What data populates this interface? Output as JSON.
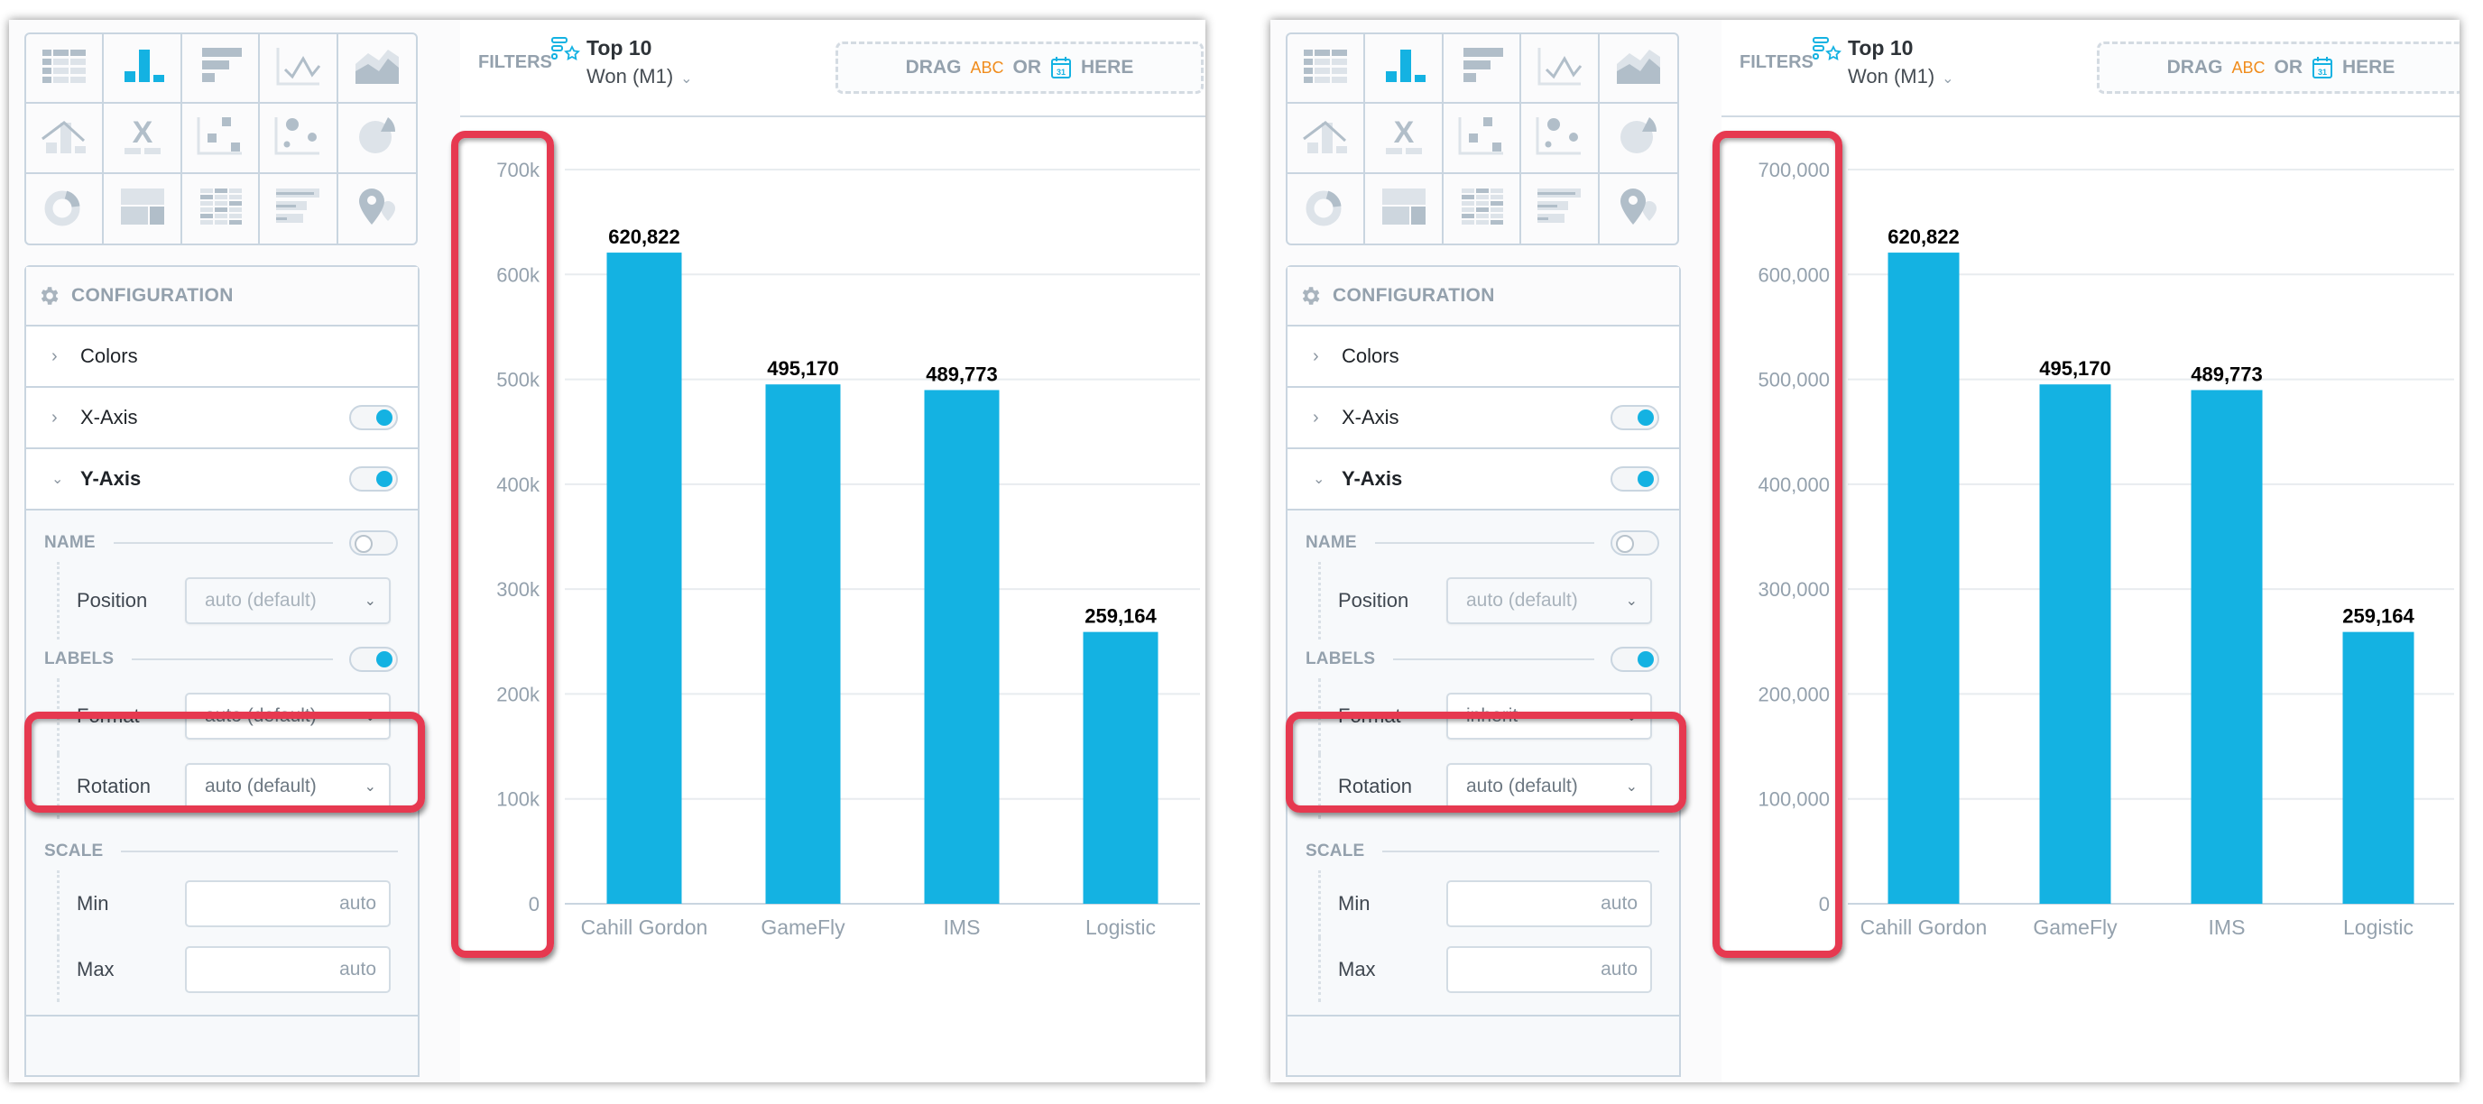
{
  "viz_types": [
    {
      "name": "table",
      "active": false
    },
    {
      "name": "column",
      "active": true
    },
    {
      "name": "bar",
      "active": false
    },
    {
      "name": "line",
      "active": false
    },
    {
      "name": "area",
      "active": false
    },
    {
      "name": "combo",
      "active": false
    },
    {
      "name": "headline",
      "active": false
    },
    {
      "name": "scatter",
      "active": false
    },
    {
      "name": "bubble",
      "active": false
    },
    {
      "name": "pie",
      "active": false
    },
    {
      "name": "donut",
      "active": false
    },
    {
      "name": "treemap",
      "active": false
    },
    {
      "name": "heatmap",
      "active": false
    },
    {
      "name": "bullet",
      "active": false
    },
    {
      "name": "geo",
      "active": false
    }
  ],
  "colors": {
    "accent": "#14b2e2",
    "bar": "#14b2e2",
    "highlight": "#e63950",
    "muted": "#94a1ad",
    "abc": "#f08c1c"
  },
  "panels": [
    {
      "config": {
        "title": "CONFIGURATION",
        "sections": [
          {
            "label": "Colors",
            "expanded": false,
            "toggle": null
          },
          {
            "label": "X-Axis",
            "expanded": false,
            "toggle": true
          },
          {
            "label": "Y-Axis",
            "expanded": true,
            "toggle": true
          }
        ],
        "name": {
          "title": "NAME",
          "enabled": false,
          "position_label": "Position",
          "position_value": "auto (default)"
        },
        "labels": {
          "title": "LABELS",
          "enabled": true,
          "format_label": "Format",
          "format_value": "auto (default)",
          "rotation_label": "Rotation",
          "rotation_value": "auto (default)"
        },
        "scale": {
          "title": "SCALE",
          "min_label": "Min",
          "min_placeholder": "auto",
          "max_label": "Max",
          "max_placeholder": "auto"
        }
      },
      "filters": {
        "label": "FILTERS",
        "chip_top": "Top 10",
        "chip_sub": "Won (M1)",
        "drop_drag": "DRAG",
        "drop_abc": "ABC",
        "drop_or": "OR",
        "drop_here": "HERE",
        "calendar_day": "31"
      },
      "chart_data": {
        "type": "bar",
        "categories": [
          "Cahill Gordon",
          "GameFly",
          "IMS",
          "Logistic"
        ],
        "values": [
          620822,
          495170,
          489773,
          259164
        ],
        "data_labels": [
          "620,822",
          "495,170",
          "489,773",
          "259,164"
        ],
        "yticks": [
          0,
          100000,
          200000,
          300000,
          400000,
          500000,
          600000,
          700000
        ],
        "ytick_labels": [
          "0",
          "100k",
          "200k",
          "300k",
          "400k",
          "500k",
          "600k",
          "700k"
        ],
        "ylim": [
          0,
          700000
        ],
        "grid": true,
        "title": "",
        "xlabel": "",
        "ylabel": ""
      }
    },
    {
      "config": {
        "title": "CONFIGURATION",
        "sections": [
          {
            "label": "Colors",
            "expanded": false,
            "toggle": null
          },
          {
            "label": "X-Axis",
            "expanded": false,
            "toggle": true
          },
          {
            "label": "Y-Axis",
            "expanded": true,
            "toggle": true
          }
        ],
        "name": {
          "title": "NAME",
          "enabled": false,
          "position_label": "Position",
          "position_value": "auto (default)"
        },
        "labels": {
          "title": "LABELS",
          "enabled": true,
          "format_label": "Format",
          "format_value": "inherit",
          "rotation_label": "Rotation",
          "rotation_value": "auto (default)"
        },
        "scale": {
          "title": "SCALE",
          "min_label": "Min",
          "min_placeholder": "auto",
          "max_label": "Max",
          "max_placeholder": "auto"
        }
      },
      "filters": {
        "label": "FILTERS",
        "chip_top": "Top 10",
        "chip_sub": "Won (M1)",
        "drop_drag": "DRAG",
        "drop_abc": "ABC",
        "drop_or": "OR",
        "drop_here": "HERE",
        "calendar_day": "31"
      },
      "chart_data": {
        "type": "bar",
        "categories": [
          "Cahill Gordon",
          "GameFly",
          "IMS",
          "Logistic"
        ],
        "values": [
          620822,
          495170,
          489773,
          259164
        ],
        "data_labels": [
          "620,822",
          "495,170",
          "489,773",
          "259,164"
        ],
        "yticks": [
          0,
          100000,
          200000,
          300000,
          400000,
          500000,
          600000,
          700000
        ],
        "ytick_labels": [
          "0",
          "100,000",
          "200,000",
          "300,000",
          "400,000",
          "500,000",
          "600,000",
          "700,000"
        ],
        "ylim": [
          0,
          700000
        ],
        "grid": true,
        "title": "",
        "xlabel": "",
        "ylabel": ""
      }
    }
  ],
  "chart_data": [
    {
      "type": "bar",
      "categories": [
        "Cahill Gordon",
        "GameFly",
        "IMS",
        "Logistic"
      ],
      "values": [
        620822,
        495170,
        489773,
        259164
      ],
      "yticks": [
        "0",
        "100k",
        "200k",
        "300k",
        "400k",
        "500k",
        "600k",
        "700k"
      ],
      "ylim": [
        0,
        700000
      ],
      "title": "",
      "xlabel": "",
      "ylabel": ""
    },
    {
      "type": "bar",
      "categories": [
        "Cahill Gordon",
        "GameFly",
        "IMS",
        "Logistic"
      ],
      "values": [
        620822,
        495170,
        489773,
        259164
      ],
      "yticks": [
        "0",
        "100,000",
        "200,000",
        "300,000",
        "400,000",
        "500,000",
        "600,000",
        "700,000"
      ],
      "ylim": [
        0,
        700000
      ],
      "title": "",
      "xlabel": "",
      "ylabel": ""
    }
  ]
}
